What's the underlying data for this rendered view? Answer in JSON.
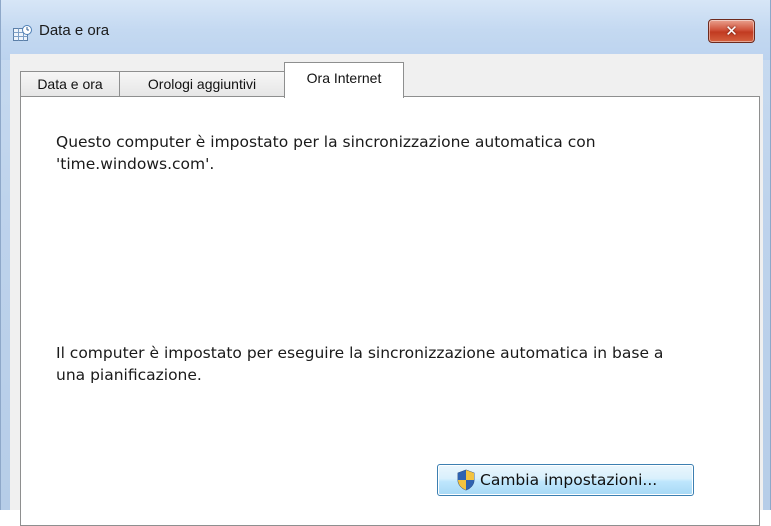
{
  "window": {
    "title": "Data e ora",
    "icon": "date-time-icon",
    "close_symbol": "✕"
  },
  "tabs": [
    {
      "label": "Data e ora",
      "active": false
    },
    {
      "label": "Orologi aggiuntivi",
      "active": false
    },
    {
      "label": "Ora Internet",
      "active": true
    }
  ],
  "panel": {
    "sync_status_line1": "Questo computer è impostato per la sincronizzazione automatica con",
    "sync_status_line2": "'time.windows.com'.",
    "schedule_line1": "Il computer è impostato per eseguire la sincronizzazione automatica in base a",
    "schedule_line2": "una pianificazione."
  },
  "buttons": {
    "change_settings": "Cambia impostazioni...",
    "change_settings_icon": "uac-shield-icon"
  }
}
